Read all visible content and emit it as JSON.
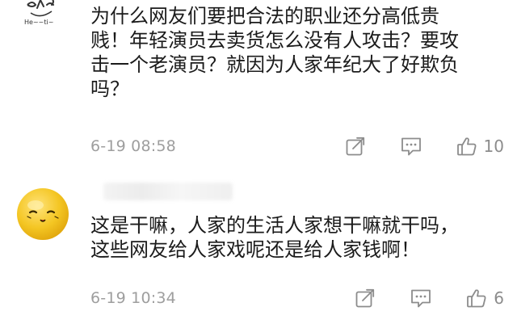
{
  "comments": [
    {
      "avatar_icon": "doodle-avatar-icon",
      "avatar_label": "He~~ti~",
      "text_lines": [
        "为什么网友们要把合法的职业还分高低贵",
        "贱！年轻演员去卖货怎么没有人攻击？要攻",
        "击一个老演员？就因为人家年纪大了好欺负",
        "吗？"
      ],
      "time": "6-19 08:58",
      "likes": "10"
    },
    {
      "avatar_icon": "smiley-avatar-icon",
      "text_lines": [
        "这是干嘛，人家的生活人家想干嘛就干吗，",
        "这些网友给人家戏呢还是给人家钱啊！"
      ],
      "time": "6-19 10:34",
      "likes": "6"
    }
  ],
  "icons": {
    "share": "share-icon",
    "reply": "comment-icon",
    "like": "thumbs-up-icon"
  },
  "colors": {
    "text": "#1b1b1b",
    "meta": "#9e9e9e",
    "icon": "#8c8c8c",
    "avatar_yellow": "#f2c21b"
  }
}
